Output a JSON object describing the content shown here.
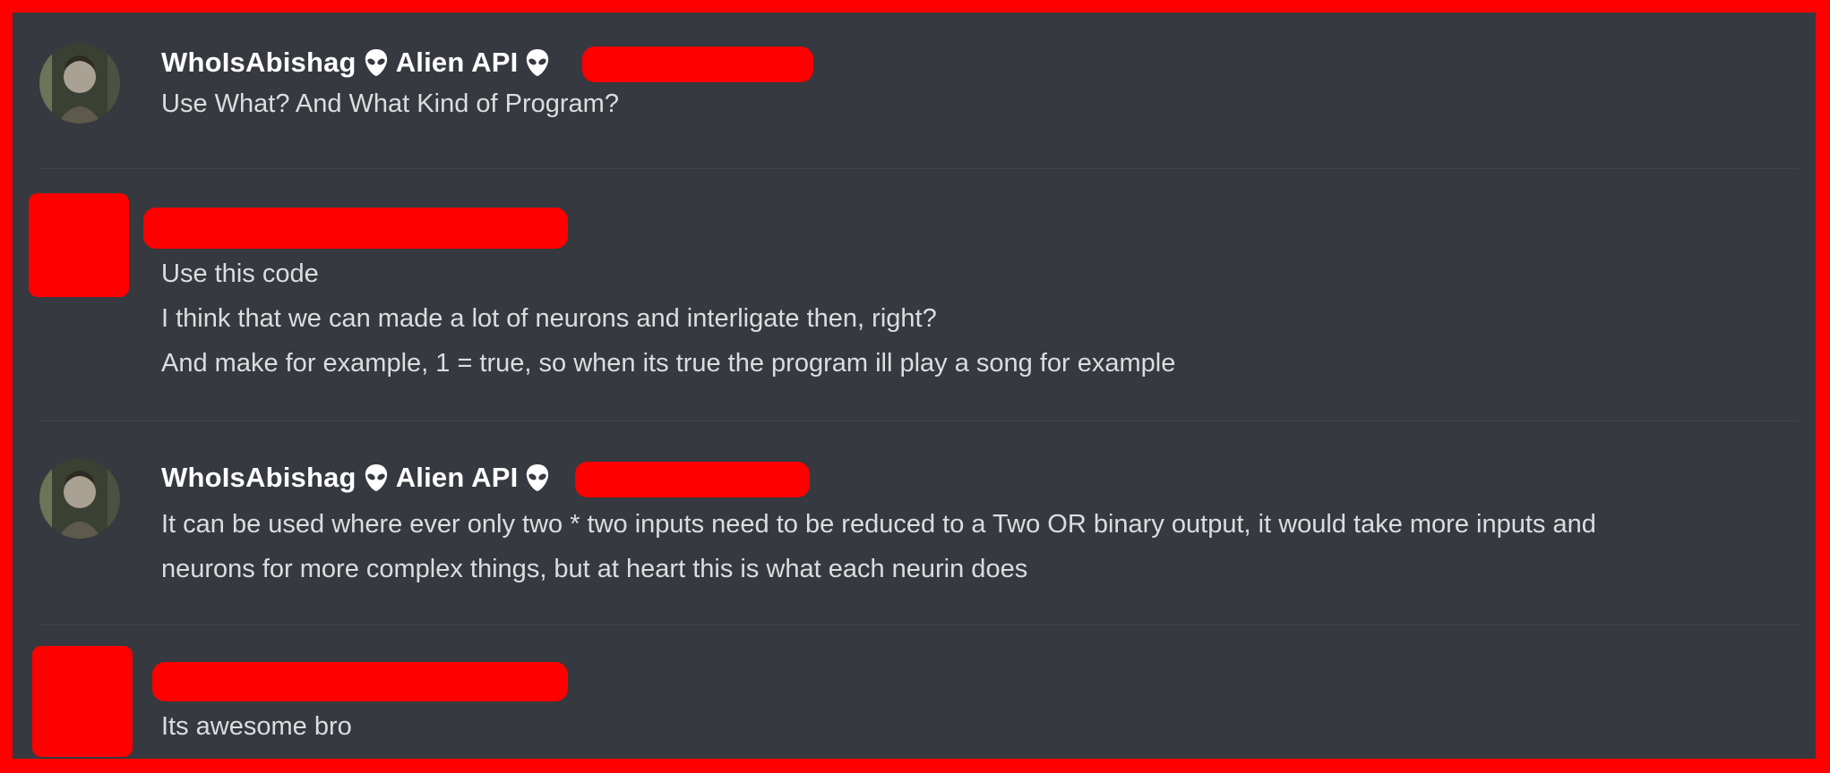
{
  "messages": [
    {
      "username": "WhoIsAbishag",
      "tag": "Alien API",
      "header_icon": "alien-icon",
      "lines": [
        "Use What? And What Kind of Program?"
      ]
    },
    {
      "username": "",
      "lines": [
        "Use this code",
        "I think that we can made a lot of neurons and interligate then, right?",
        "And make for example, 1 = true, so when its true the program ill play a song for example"
      ]
    },
    {
      "username": "WhoIsAbishag",
      "tag": "Alien API",
      "header_icon": "alien-icon",
      "lines": [
        "It can be used where ever only two * two inputs need to be reduced to a Two OR binary output, it would take more inputs and",
        "neurons for more complex things, but at heart this is what each neurin does"
      ]
    },
    {
      "username": "",
      "lines": [
        "Its awesome bro"
      ]
    }
  ],
  "colors": {
    "frame_border": "#ff0000",
    "background": "#36393f",
    "username": "#ffffff",
    "message_text": "#dcddde",
    "redaction": "#ff0000"
  }
}
